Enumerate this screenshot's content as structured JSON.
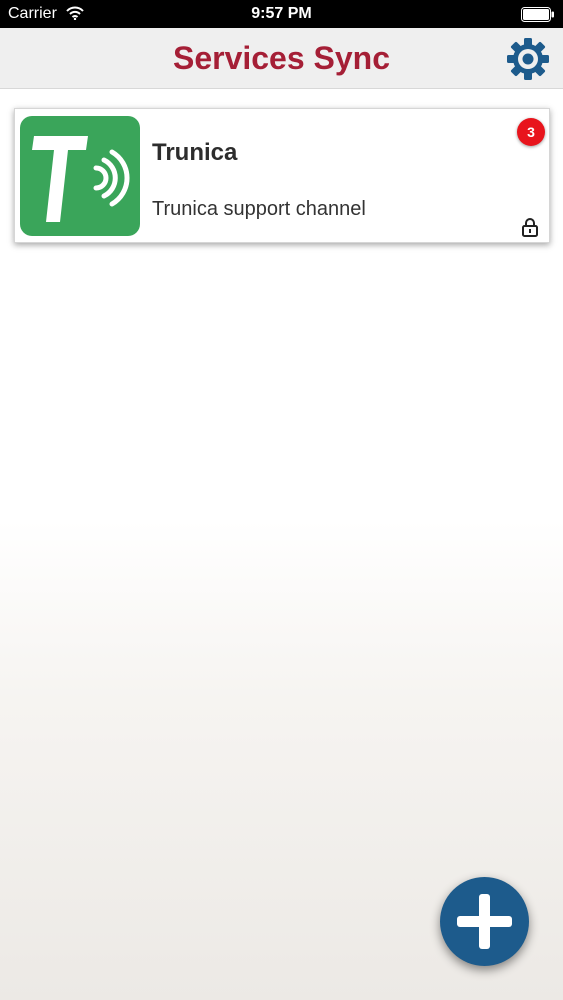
{
  "status_bar": {
    "carrier": "Carrier",
    "time": "9:57 PM",
    "wifi_icon": "wifi-icon",
    "battery_icon": "battery-full-icon"
  },
  "nav": {
    "title": "Services Sync",
    "title_color": "#a51f36",
    "settings_icon": "gear-icon",
    "settings_color": "#1d5b8c"
  },
  "services": [
    {
      "title": "Trunica",
      "subtitle": "Trunica support channel",
      "logo_icon": "trunica-logo",
      "logo_color": "#3aa55a",
      "badge": "3",
      "locked_icon": "lock-icon"
    }
  ],
  "fab": {
    "icon": "plus-icon",
    "color": "#1d5b8c"
  }
}
